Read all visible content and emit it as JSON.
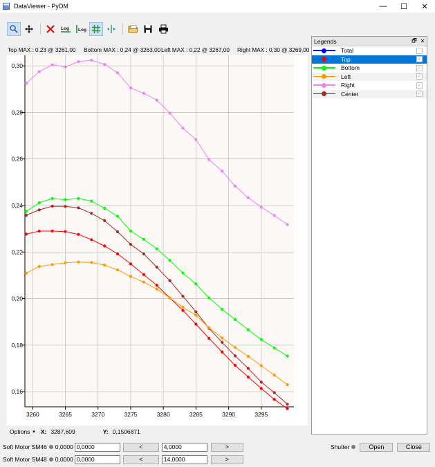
{
  "window": {
    "title": "DataViewer - PyDM",
    "controls": {
      "minimize": "—",
      "maximize": "☐",
      "close": "✕"
    }
  },
  "toolbar": {
    "buttons": [
      {
        "name": "zoom-tool",
        "icon": "magnifier-icon",
        "active": true
      },
      {
        "name": "pan-tool",
        "icon": "move-arrows-icon",
        "active": false
      },
      {
        "name": "clear-plot",
        "icon": "red-x-icon",
        "active": false
      },
      {
        "name": "log-x",
        "icon": "log-x-icon",
        "text": "Log",
        "active": false
      },
      {
        "name": "log-y",
        "icon": "log-y-icon",
        "text": "Log",
        "active": false
      },
      {
        "name": "toggle-grid",
        "icon": "grid-icon",
        "active": true
      },
      {
        "name": "crosshair",
        "icon": "crosshair-icon",
        "active": false
      },
      {
        "name": "open-config",
        "icon": "folder-icon",
        "active": false
      },
      {
        "name": "save",
        "icon": "floppy-disk-icon",
        "active": false
      },
      {
        "name": "print",
        "icon": "printer-icon",
        "active": false
      }
    ]
  },
  "max_labels": {
    "top": "Top MAX : 0,23 @ 3261,00",
    "bottom": "Bottom MAX : 0,24 @ 3263,00",
    "left": "Left MAX : 0,22 @ 3267,00",
    "right": "Right MAX : 0,30 @ 3269,00"
  },
  "legend": {
    "title": "Legends",
    "float_icon": "🗗",
    "close_icon": "✕",
    "items": [
      {
        "label": "Total",
        "color": "#0000ff",
        "checked": false,
        "selected": false
      },
      {
        "label": "Top",
        "color": "#ff0000",
        "checked": true,
        "selected": true
      },
      {
        "label": "Bottom",
        "color": "#00ff00",
        "checked": true,
        "selected": false
      },
      {
        "label": "Left",
        "color": "#ff9900",
        "checked": true,
        "selected": false
      },
      {
        "label": "Right",
        "color": "#ee82ee",
        "checked": true,
        "selected": false
      },
      {
        "label": "Center",
        "color": "#a52a2a",
        "checked": true,
        "selected": false
      }
    ]
  },
  "chart_data": {
    "type": "line",
    "title": "",
    "xlabel": "",
    "ylabel": "",
    "xlim": [
      3258.8,
      3300.0
    ],
    "ylim": [
      0.1535,
      0.3045
    ],
    "x_ticks": [
      3260,
      3265,
      3270,
      3275,
      3280,
      3285,
      3290,
      3295
    ],
    "y_ticks": [
      0.16,
      0.18,
      0.2,
      0.22,
      0.24,
      0.26,
      0.28,
      0.3
    ],
    "y_tick_labels": [
      "0,16",
      "0,18",
      "0,20",
      "0,22",
      "0,24",
      "0,26",
      "0,28",
      "0,30"
    ],
    "grid": true,
    "x": [
      3259,
      3261,
      3263,
      3265,
      3267,
      3269,
      3271,
      3273,
      3275,
      3277,
      3279,
      3281,
      3283,
      3285,
      3287,
      3289,
      3291,
      3293,
      3295,
      3297,
      3299
    ],
    "series": [
      {
        "name": "Right",
        "color": "#ee82ee",
        "values": [
          0.2925,
          0.2975,
          0.3004,
          0.2995,
          0.3018,
          0.3024,
          0.3006,
          0.297,
          0.2905,
          0.2882,
          0.2853,
          0.2797,
          0.2732,
          0.2683,
          0.2597,
          0.2548,
          0.2483,
          0.2433,
          0.2393,
          0.2357,
          0.2318
        ]
      },
      {
        "name": "Bottom",
        "color": "#00ff00",
        "values": [
          0.2374,
          0.2412,
          0.243,
          0.2425,
          0.243,
          0.2419,
          0.2388,
          0.2354,
          0.229,
          0.2255,
          0.2214,
          0.2164,
          0.211,
          0.2063,
          0.2003,
          0.1954,
          0.191,
          0.1866,
          0.1824,
          0.1788,
          0.1753
        ]
      },
      {
        "name": "Center",
        "color": "#a52a2a",
        "values": [
          0.2358,
          0.2381,
          0.2397,
          0.2396,
          0.239,
          0.2366,
          0.2335,
          0.2287,
          0.2233,
          0.2192,
          0.2135,
          0.2077,
          0.201,
          0.1943,
          0.1872,
          0.1812,
          0.1754,
          0.17,
          0.1641,
          0.1596,
          0.1546
        ]
      },
      {
        "name": "Top",
        "color": "#ff0000",
        "values": [
          0.2277,
          0.229,
          0.229,
          0.2288,
          0.2276,
          0.2253,
          0.2226,
          0.2192,
          0.2149,
          0.2103,
          0.2057,
          0.2003,
          0.1949,
          0.189,
          0.1829,
          0.1771,
          0.1713,
          0.1663,
          0.1614,
          0.1567,
          0.1527
        ]
      },
      {
        "name": "Left",
        "color": "#ff9900",
        "values": [
          0.2109,
          0.2138,
          0.2146,
          0.2154,
          0.2157,
          0.2155,
          0.2144,
          0.2123,
          0.2095,
          0.2071,
          0.2041,
          0.2003,
          0.1963,
          0.1928,
          0.1875,
          0.1831,
          0.179,
          0.1752,
          0.1712,
          0.1671,
          0.163
        ]
      }
    ]
  },
  "status": {
    "options_label": "Options",
    "x_label": "X:",
    "x_value": "3287,609",
    "y_label": "Y:",
    "y_value": "0,1506871"
  },
  "motors": [
    {
      "label": "Soft Motor SM46",
      "readback": "0,0000",
      "setpoint": "0,0000",
      "minus_label": "<",
      "step": "4,0000",
      "plus_label": ">"
    },
    {
      "label": "Soft Motor SM48",
      "readback": "0,0000",
      "setpoint": "0,0000",
      "minus_label": "<",
      "step": "14,0000",
      "plus_label": ">"
    }
  ],
  "shutter": {
    "label": "Shutter",
    "open_label": "Open",
    "close_label": "Close"
  }
}
